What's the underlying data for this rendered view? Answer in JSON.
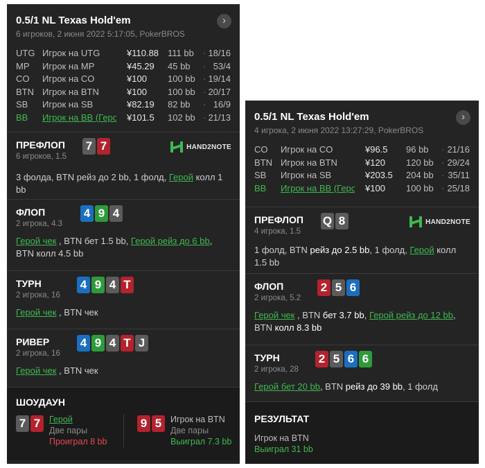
{
  "left": {
    "title": "0.5/1 NL Texas Hold'em",
    "meta": "6 игроков, 2 июня 2022 5:17:05, PokerBROS",
    "players": [
      {
        "pos": "UTG",
        "name": "Игрок на UTG",
        "money": "¥110.88",
        "bb": "111 bb",
        "sep": "·",
        "stat": "18/16"
      },
      {
        "pos": "MP",
        "name": "Игрок на MP",
        "money": "¥45.29",
        "bb": "45 bb",
        "sep": "·",
        "stat": "53/4"
      },
      {
        "pos": "CO",
        "name": "Игрок на CO",
        "money": "¥100",
        "bb": "100 bb",
        "sep": "·",
        "stat": "19/14"
      },
      {
        "pos": "BTN",
        "name": "Игрок на BTN",
        "money": "¥100",
        "bb": "100 bb",
        "sep": "·",
        "stat": "20/17"
      },
      {
        "pos": "SB",
        "name": "Игрок на SB",
        "money": "¥82.19",
        "bb": "82 bb",
        "sep": "·",
        "stat": "16/9"
      },
      {
        "pos": "BB",
        "name": "Игрок на BB (Герой)",
        "money": "¥101.5",
        "bb": "102 bb",
        "sep": "·",
        "stat": "21/13"
      }
    ],
    "preflop": {
      "title": "ПРЕФЛОП",
      "sub": "6 игроков, 1.5",
      "logo": "HAND2NOTE",
      "a1": "3 фолда, BTN рейз до 2 bb, 1 фолд, ",
      "hero": "Герой",
      "a2": " колл 1 bb"
    },
    "flop": {
      "title": "ФЛОП",
      "sub": "2 игрока, 4.3",
      "hero1": "Герой чек",
      "a1": " , BTN бет 1.5 bb, ",
      "hero2": "Герой рейз до 6 bb",
      "a2": ", BTN колл 4.5 bb"
    },
    "turn": {
      "title": "ТУРН",
      "sub": "2 игрока, 16",
      "hero": "Герой чек",
      "a1": " , BTN чек"
    },
    "river": {
      "title": "РИВЕР",
      "sub": "2 игрока, 16",
      "hero": "Герой чек",
      "a1": " , BTN чек"
    },
    "showdown": {
      "title": "ШОУДАУН",
      "p1": {
        "name": "Герой",
        "hand": "Две пары",
        "result": "Проиграл 8 bb"
      },
      "p2": {
        "name": "Игрок на BTN",
        "hand": "Две пары",
        "result": "Выиграл 7.3 bb"
      }
    },
    "cards": {
      "hole": [
        "7",
        "7"
      ],
      "flop": [
        "4",
        "9",
        "4"
      ],
      "turn": [
        "4",
        "9",
        "4",
        "T"
      ],
      "river": [
        "4",
        "9",
        "4",
        "T",
        "J"
      ],
      "sd1": [
        "7",
        "7"
      ],
      "sd2": [
        "9",
        "5"
      ]
    }
  },
  "right": {
    "title": "0.5/1 NL Texas Hold'em",
    "meta": "4 игрока, 2 июня 2022 13:27:29, PokerBROS",
    "players": [
      {
        "pos": "CO",
        "name": "Игрок на CO",
        "money": "¥96.5",
        "bb": "96 bb",
        "sep": "·",
        "stat": "21/16"
      },
      {
        "pos": "BTN",
        "name": "Игрок на BTN",
        "money": "¥120",
        "bb": "120 bb",
        "sep": "·",
        "stat": "29/24"
      },
      {
        "pos": "SB",
        "name": "Игрок на SB",
        "money": "¥203.5",
        "bb": "204 bb",
        "sep": "·",
        "stat": "35/11"
      },
      {
        "pos": "BB",
        "name": "Игрок на BB (Герой)",
        "money": "¥100",
        "bb": "100 bb",
        "sep": "·",
        "stat": "25/18"
      }
    ],
    "preflop": {
      "title": "ПРЕФЛОП",
      "sub": "4 игрока, 1.5",
      "logo": "HAND2NOTE",
      "a1": "1 фолд, BTN ",
      "b1": "рейз до 2.5 bb",
      "a2": ", 1 фолд, ",
      "hero": "Герой",
      "a3": " колл 1.5 bb"
    },
    "flop": {
      "title": "ФЛОП",
      "sub": "2 игрока, 5.2",
      "hero1": "Герой чек",
      "a1": " , BTN ",
      "b1": "бет 3.7 bb",
      "a2": ", ",
      "hero2": "Герой рейз до 12 bb",
      "a3": ", BTN ",
      "b2": "колл 8.3 bb"
    },
    "turn": {
      "title": "ТУРН",
      "sub": "2 игрока, 28",
      "hero": "Герой бет 20 bb",
      "a1": ", BTN ",
      "b1": "рейз до 39 bb",
      "a2": ", 1 фолд"
    },
    "result": {
      "title": "РЕЗУЛЬТАТ",
      "name": "Игрок на BTN",
      "result": "Выиграл 31 bb"
    },
    "cards": {
      "hole": [
        "Q",
        "8"
      ],
      "flop": [
        "2",
        "5",
        "6"
      ],
      "turn": [
        "2",
        "5",
        "6",
        "6"
      ]
    }
  },
  "colors": {
    "hero": "#3fb950",
    "spade": "#5b5b5b",
    "heart": "#b2232e",
    "diamond": "#1b6fbf",
    "club": "#2f9a3c",
    "lost": "#e5484d"
  },
  "icons": {
    "chevron": "chevron-right-icon",
    "logo": "hand2note-logo"
  }
}
